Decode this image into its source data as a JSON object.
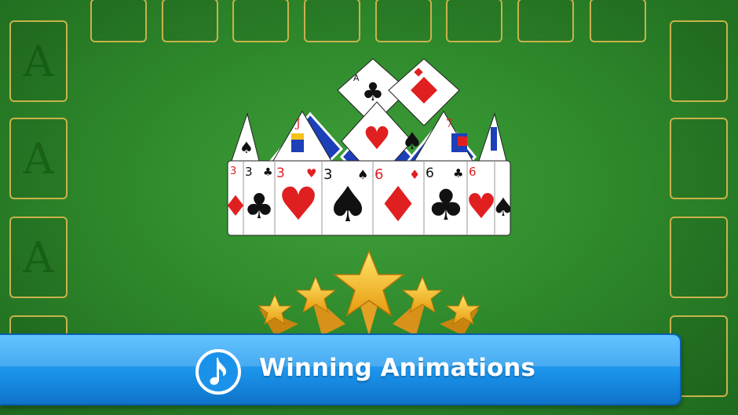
{
  "banner": {
    "title": "Winning Animations",
    "icon": "music-note-icon"
  },
  "foundations": [
    {
      "label": "A"
    },
    {
      "label": "A"
    },
    {
      "label": "A"
    }
  ],
  "colors": {
    "felt": "#2f8a2c",
    "slot_border": "#c9b24a",
    "banner": "#1a92ea",
    "card_red": "#e02020",
    "card_blue": "#1d3fb8",
    "star_gold": "#f5c21b"
  },
  "crown": {
    "top_cards": [
      "A♣",
      "A♦"
    ],
    "band_cards": [
      "3♦",
      "3♣",
      "3♥",
      "3♠",
      "6♦",
      "6♣",
      "6♥",
      "6♠"
    ],
    "points": [
      "J",
      "7"
    ]
  }
}
